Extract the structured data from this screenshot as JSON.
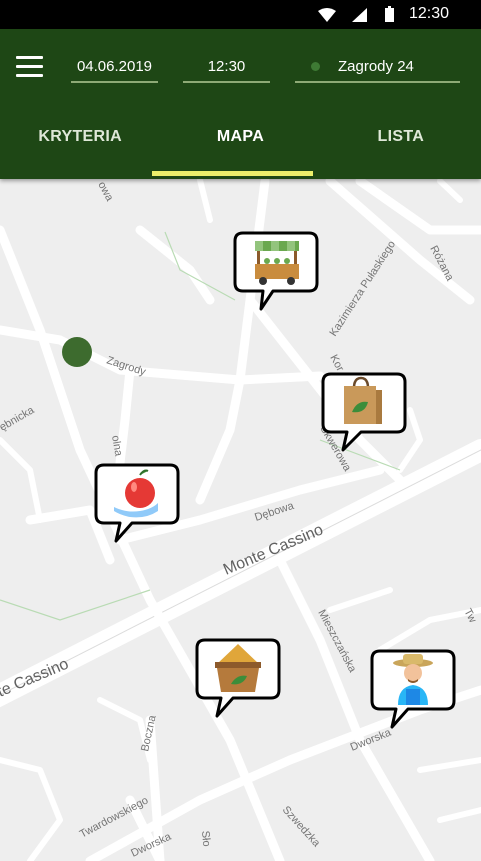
{
  "status_bar": {
    "time": "12:30"
  },
  "header": {
    "menu_icon": "hamburger-menu-icon",
    "date": "04.06.2019",
    "time": "12:30",
    "location": "Zagrody 24"
  },
  "tabs": [
    {
      "label": "KRYTERIA",
      "active": false
    },
    {
      "label": "MAPA",
      "active": true
    },
    {
      "label": "LISTA",
      "active": false
    }
  ],
  "colors": {
    "header_bg": "#1e4715",
    "tab_indicator": "#ecef6b",
    "location_dot": "#3e7a34"
  },
  "map": {
    "streets": {
      "zagrody": "Zagrody",
      "debowa": "Dębowa",
      "monte_cassino": "Monte Cassino",
      "monte_cassino_left": "te Cassino",
      "skwerowa": "Skwerowa",
      "kazimierza": "Kazimierza Pułaskiego",
      "rozana": "Różana",
      "mieszczanska": "Mieszczańska",
      "dworska": "Dworska",
      "dworska_bottom": "Dworska",
      "boczna": "Boczna",
      "twardowskiego": "Twardowskiego",
      "szwedzka": "Szwedzka",
      "debnicka": "ębnicka",
      "polna": "olna",
      "owa": "owa",
      "kor": "Kor",
      "slo": "Sło",
      "tw": "Tw"
    },
    "markers": [
      {
        "name": "market-stall-icon"
      },
      {
        "name": "shopping-bag-icon"
      },
      {
        "name": "apple-in-hand-icon"
      },
      {
        "name": "grain-sack-icon"
      },
      {
        "name": "farmer-icon"
      }
    ]
  }
}
